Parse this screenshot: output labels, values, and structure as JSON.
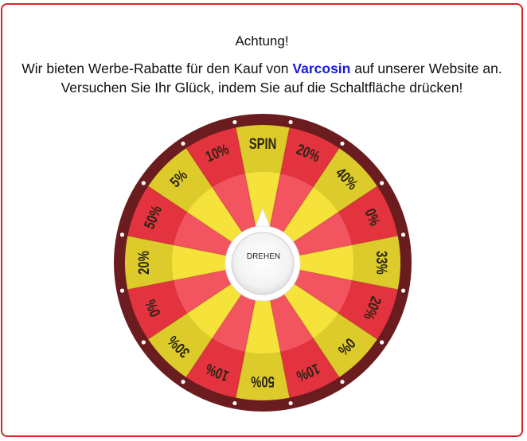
{
  "modal": {
    "title": "Achtung!",
    "line1_before": "Wir bieten Werbe-Rabatte für den Kauf von ",
    "brand": "Varcosin",
    "line1_after": " auf unserer Website an.",
    "line2": "Versuchen Sie Ihr Glück, indem Sie auf die Schaltfläche drücken!",
    "accent_color": "#d9232a",
    "brand_color": "#1a1adc"
  },
  "wheel": {
    "spin_button_label": "DREHEN",
    "segments": [
      {
        "label": "SPIN",
        "color": "yellow"
      },
      {
        "label": "20%",
        "color": "red"
      },
      {
        "label": "40%",
        "color": "yellow"
      },
      {
        "label": "0%",
        "color": "red"
      },
      {
        "label": "33%",
        "color": "yellow"
      },
      {
        "label": "20%",
        "color": "red"
      },
      {
        "label": "0%",
        "color": "yellow"
      },
      {
        "label": "10%",
        "color": "red"
      },
      {
        "label": "50%",
        "color": "yellow"
      },
      {
        "label": "10%",
        "color": "red"
      },
      {
        "label": "30%",
        "color": "yellow"
      },
      {
        "label": "0%",
        "color": "red"
      },
      {
        "label": "20%",
        "color": "yellow"
      },
      {
        "label": "50%",
        "color": "red"
      },
      {
        "label": "5%",
        "color": "yellow"
      },
      {
        "label": "10%",
        "color": "red"
      }
    ],
    "colors": {
      "red": "#e2333e",
      "red_inner": "#f25560",
      "yellow": "#dccb2a",
      "yellow_inner": "#f5e23a",
      "rim": "#6b1c1f",
      "label": "#2b2416"
    }
  }
}
